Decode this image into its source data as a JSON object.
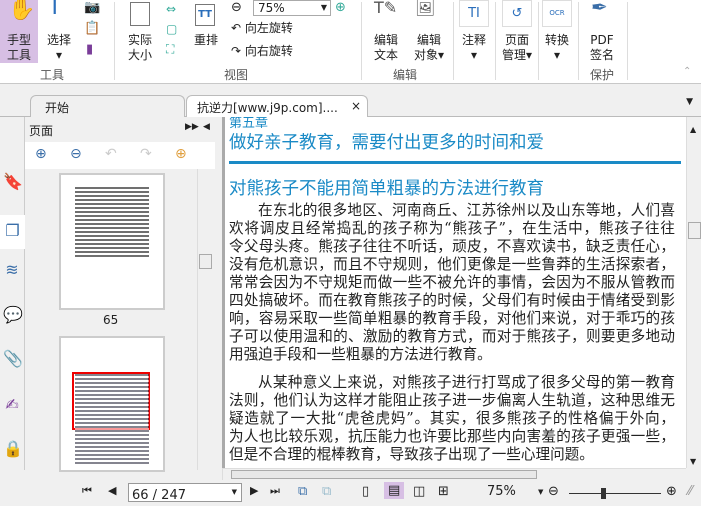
{
  "ribbon": {
    "hand_tool": "手型\n工具",
    "hand_1": "手型",
    "hand_2": "工具",
    "select": "选择",
    "actual_1": "实际",
    "actual_2": "大小",
    "reflow": "重排",
    "zoom_value": "75%",
    "rotate_left": "向左旋转",
    "rotate_right": "向右旋转",
    "edit_text_1": "编辑",
    "edit_text_2": "文本",
    "edit_obj_1": "编辑",
    "edit_obj_2": "对象",
    "annotate": "注释",
    "page_1": "页面",
    "page_2": "管理",
    "convert": "转换",
    "pdf_1": "PDF",
    "pdf_2": "签名",
    "groups": {
      "tools": "工具",
      "view": "视图",
      "edit": "编辑",
      "protect": "保护"
    }
  },
  "tabs": [
    {
      "label": "开始"
    },
    {
      "label": "抗逆力[www.j9p.com]...."
    }
  ],
  "panel": {
    "title": "页面",
    "thumb_label": "65"
  },
  "document": {
    "chapter": "第五章",
    "chapter_title": "做好亲子教育，需要付出更多的时间和爱",
    "section_title": "对熊孩子不能用简单粗暴的方法进行教育",
    "para1": [
      "在东北的很多地区、河南商丘、江苏徐州以及山东等地，人们喜",
      "欢将调皮且经常捣乱的孩子称为“熊孩子”，在生活中，熊孩子往往",
      "令父母头疼。熊孩子往往不听话，顽皮，不喜欢读书，缺乏责任心，",
      "没有危机意识，而且不守规则，他们更像是一些鲁莽的生活探索者，",
      "常常会因为不守规矩而做一些不被允许的事情，会因为不服从管教而",
      "四处搞破坏。而在教育熊孩子的时候，父母们有时候由于情绪受到影",
      "响，容易采取一些简单粗暴的教育手段，对他们来说，对于乖巧的孩",
      "子可以使用温和的、激励的教育方式，而对于熊孩子，则要更多地动",
      "用强迫手段和一些粗暴的方法进行教育。"
    ],
    "para2": [
      "从某种意义上来说，对熊孩子进行打骂成了很多父母的第一教育",
      "法则，他们认为这样才能阻止孩子进一步偏离人生轨道，这种思维无",
      "疑造就了一大批“虎爸虎妈”。其实，很多熊孩子的性格偏于外向，",
      "为人也比较乐观，抗压能力也许要比那些内向害羞的孩子更强一些，",
      "但是不合理的棍棒教育，导致孩子出现了一些心理问题。"
    ]
  },
  "status": {
    "page": "66 / 247",
    "zoom": "75%",
    "zoom_fraction": 0.37
  },
  "colors": {
    "accent": "#1a8ac6",
    "hand_bg": "#d7bfe4"
  }
}
